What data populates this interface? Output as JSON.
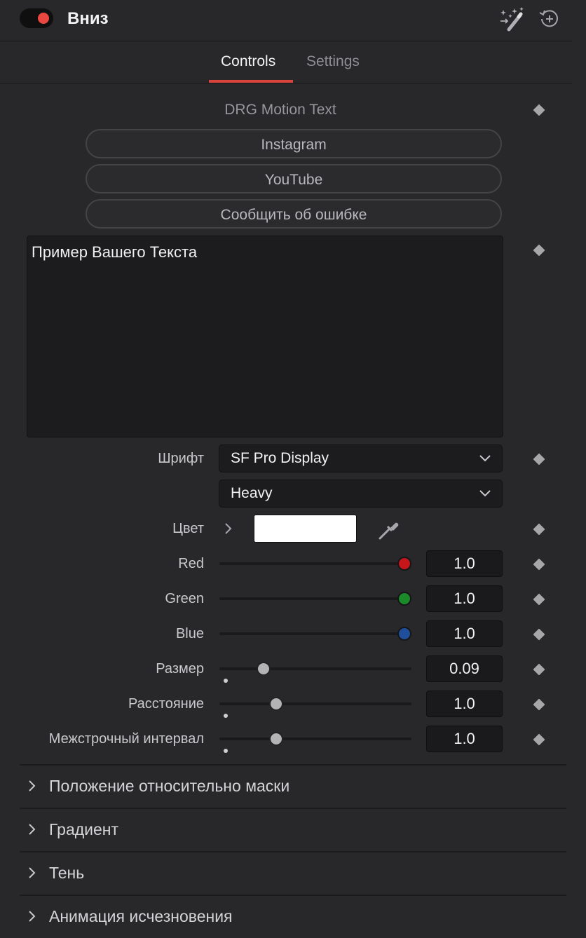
{
  "header": {
    "title": "Вниз",
    "toggle_on_color": "#e9473f",
    "icons": [
      "magic-wand-icon",
      "reset-icon"
    ]
  },
  "tabs": [
    {
      "label": "Controls",
      "active": true
    },
    {
      "label": "Settings",
      "active": false
    }
  ],
  "section_label": "DRG Motion Text",
  "buttons": {
    "instagram": "Instagram",
    "youtube": "YouTube",
    "report": "Сообщить об ошибке"
  },
  "text_input": {
    "value": "Пример Вашего Текста"
  },
  "font": {
    "label": "Шрифт",
    "family": "SF Pro Display",
    "style": "Heavy"
  },
  "color": {
    "label": "Цвет",
    "swatch": "#ffffff"
  },
  "sliders": {
    "red": {
      "label": "Red",
      "value": "1.0",
      "fraction": 1.0,
      "knob_color": "#c4161b"
    },
    "green": {
      "label": "Green",
      "value": "1.0",
      "fraction": 1.0,
      "knob_color": "#1a8a2a"
    },
    "blue": {
      "label": "Blue",
      "value": "1.0",
      "fraction": 1.0,
      "knob_color": "#1f4e9a"
    },
    "size": {
      "label": "Размер",
      "value": "0.09",
      "fraction": 0.2
    },
    "spacing": {
      "label": "Расстояние",
      "value": "1.0",
      "fraction": 0.27
    },
    "leading": {
      "label": "Межстрочный интервал",
      "value": "1.0",
      "fraction": 0.27
    }
  },
  "sections": [
    {
      "label": "Положение относительно маски"
    },
    {
      "label": "Градиент"
    },
    {
      "label": "Тень"
    },
    {
      "label": "Анимация исчезновения"
    }
  ],
  "colors": {
    "accent": "#d9453d",
    "background": "#28282b"
  }
}
